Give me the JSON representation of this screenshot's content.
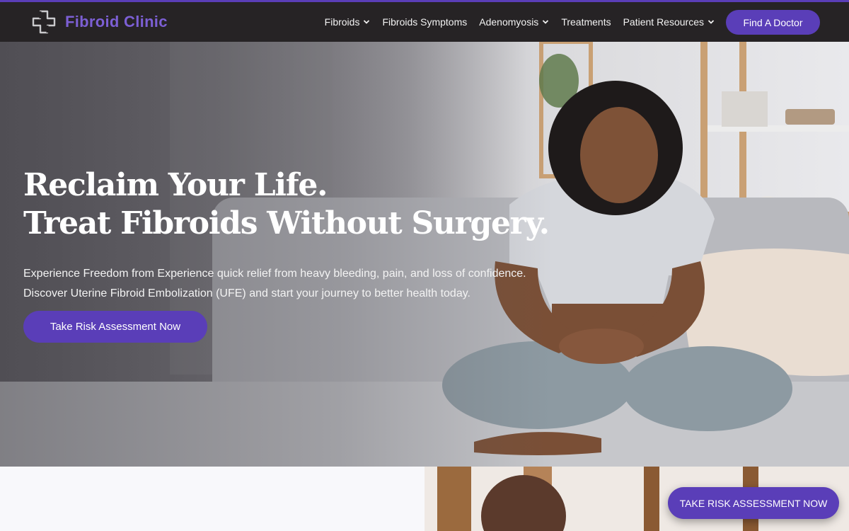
{
  "header": {
    "brand": "Fibroid Clinic",
    "logo_icon": "cross-outline-icon",
    "nav": [
      {
        "label": "Fibroids",
        "dropdown": true
      },
      {
        "label": "Fibroids Symptoms",
        "dropdown": false
      },
      {
        "label": "Adenomyosis",
        "dropdown": true
      },
      {
        "label": "Treatments",
        "dropdown": false
      },
      {
        "label": "Patient Resources",
        "dropdown": true
      }
    ],
    "find_doctor_label": "Find A Doctor"
  },
  "hero": {
    "title_line1": "Reclaim Your Life.",
    "title_line2": "Treat Fibroids Without Surgery.",
    "subtitle_line1": "Experience Freedom from Experience quick relief from heavy bleeding, pain, and loss of confidence.",
    "subtitle_line2": "Discover Uterine Fibroid Embolization (UFE) and start your journey to better health today.",
    "cta_label": "Take Risk Assessment Now"
  },
  "floating_cta": {
    "label": "TAKE RISK ASSESSMENT NOW"
  },
  "colors": {
    "accent": "#5a3eb8",
    "brand_text": "#7c5fd4",
    "header_bg": "#262325"
  }
}
